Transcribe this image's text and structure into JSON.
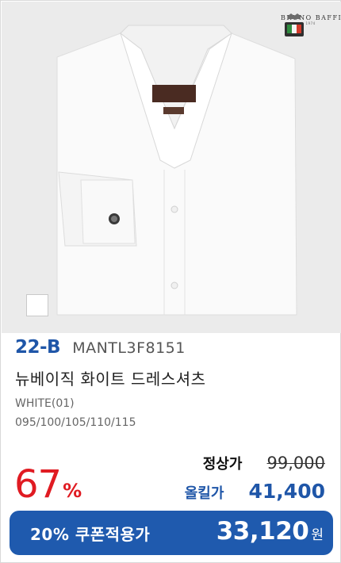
{
  "product": {
    "brand": {
      "name": "BRUNO BAFFI",
      "since": "est. 1974"
    },
    "code": "22-B",
    "model": "MANTL3F8151",
    "name": "뉴베이직 화이트 드레스셔츠",
    "color": "WHITE(01)",
    "sizes": "095/100/105/110/115",
    "swatch_color": "#ffffff"
  },
  "pricing": {
    "discount_value": "67",
    "discount_unit": "%",
    "regular_label": "정상가",
    "regular_price": "99,000",
    "sale_label": "올킬가",
    "sale_price": "41,400",
    "coupon_label": "20% 쿠폰적용가",
    "coupon_price": "33,120",
    "coupon_unit": "원"
  },
  "colors": {
    "accent_blue": "#1f56a8",
    "discount_red": "#e01b22"
  }
}
